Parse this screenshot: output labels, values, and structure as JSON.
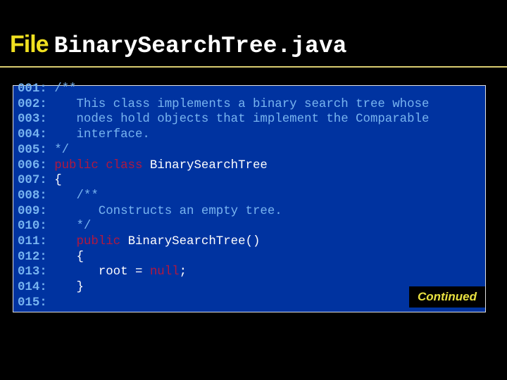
{
  "title": {
    "prefix": "File",
    "filename": "BinarySearchTree.java"
  },
  "colors": {
    "background": "#000000",
    "code_bg": "#0033a0",
    "comment": "#78b4f0",
    "keyword": "#b01840",
    "text": "#ffffff",
    "accent": "#f0e020"
  },
  "lines": [
    {
      "num": "001:",
      "parts": [
        {
          "type": "c",
          "text": "/**"
        }
      ]
    },
    {
      "num": "002:",
      "parts": [
        {
          "type": "c",
          "text": "   This class implements a binary search tree whose"
        }
      ]
    },
    {
      "num": "003:",
      "parts": [
        {
          "type": "c",
          "text": "   nodes hold objects that implement the Comparable"
        }
      ]
    },
    {
      "num": "004:",
      "parts": [
        {
          "type": "c",
          "text": "   interface."
        }
      ]
    },
    {
      "num": "005:",
      "parts": [
        {
          "type": "c",
          "text": "*/"
        }
      ]
    },
    {
      "num": "006:",
      "parts": [
        {
          "type": "k",
          "text": "public class "
        },
        {
          "type": "t",
          "text": "BinarySearchTree"
        }
      ]
    },
    {
      "num": "007:",
      "parts": [
        {
          "type": "t",
          "text": "{"
        }
      ]
    },
    {
      "num": "008:",
      "parts": [
        {
          "type": "c",
          "text": "   /**"
        }
      ]
    },
    {
      "num": "009:",
      "parts": [
        {
          "type": "c",
          "text": "      Constructs an empty tree."
        }
      ]
    },
    {
      "num": "010:",
      "parts": [
        {
          "type": "c",
          "text": "   */"
        }
      ]
    },
    {
      "num": "011:",
      "parts": [
        {
          "type": "k",
          "text": "   public "
        },
        {
          "type": "t",
          "text": "BinarySearchTree()"
        }
      ]
    },
    {
      "num": "012:",
      "parts": [
        {
          "type": "t",
          "text": "   {"
        }
      ]
    },
    {
      "num": "013:",
      "parts": [
        {
          "type": "t",
          "text": "      root = "
        },
        {
          "type": "k",
          "text": "null"
        },
        {
          "type": "t",
          "text": ";"
        }
      ]
    },
    {
      "num": "014:",
      "parts": [
        {
          "type": "t",
          "text": "   }"
        }
      ]
    },
    {
      "num": "015:",
      "parts": []
    }
  ],
  "continued_label": "Continued"
}
